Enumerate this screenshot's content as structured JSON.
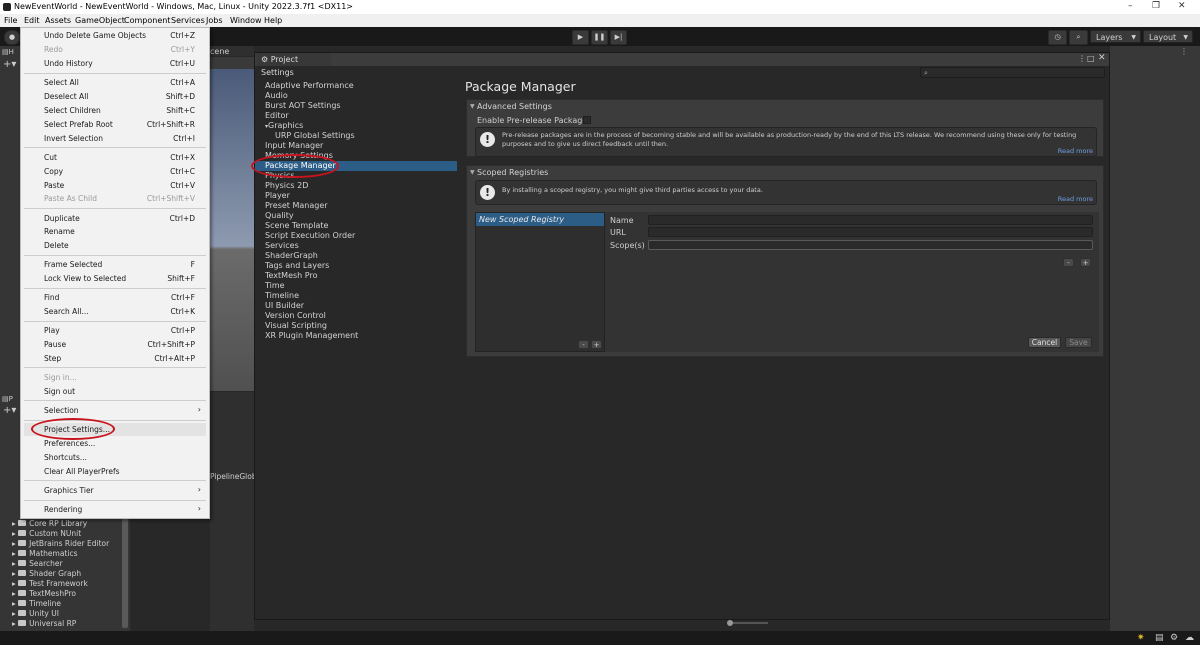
{
  "titlebar": {
    "title": "NewEventWorld - NewEventWorld - Windows, Mac, Linux - Unity 2022.3.7f1 <DX11>",
    "minimize": "–",
    "maximize": "❐",
    "close": "✕"
  },
  "menubar": [
    "File",
    "Edit",
    "Assets",
    "GameObject",
    "Component",
    "Services",
    "Jobs",
    "Window",
    "Help"
  ],
  "toolbar": {
    "layers": "Layers",
    "layout": "Layout"
  },
  "tabs": {
    "scene": "cene"
  },
  "edit_menu": {
    "items": [
      {
        "label": "Undo Delete Game Objects",
        "shortcut": "Ctrl+Z"
      },
      {
        "label": "Redo",
        "shortcut": "Ctrl+Y",
        "disabled": true
      },
      {
        "label": "Undo History",
        "shortcut": "Ctrl+U"
      },
      {
        "label": "Select All",
        "shortcut": "Ctrl+A"
      },
      {
        "label": "Deselect All",
        "shortcut": "Shift+D"
      },
      {
        "label": "Select Children",
        "shortcut": "Shift+C"
      },
      {
        "label": "Select Prefab Root",
        "shortcut": "Ctrl+Shift+R"
      },
      {
        "label": "Invert Selection",
        "shortcut": "Ctrl+I"
      },
      {
        "label": "Cut",
        "shortcut": "Ctrl+X"
      },
      {
        "label": "Copy",
        "shortcut": "Ctrl+C"
      },
      {
        "label": "Paste",
        "shortcut": "Ctrl+V"
      },
      {
        "label": "Paste As Child",
        "shortcut": "Ctrl+Shift+V",
        "disabled": true
      },
      {
        "label": "Duplicate",
        "shortcut": "Ctrl+D"
      },
      {
        "label": "Rename",
        "shortcut": ""
      },
      {
        "label": "Delete",
        "shortcut": ""
      },
      {
        "label": "Frame Selected",
        "shortcut": "F"
      },
      {
        "label": "Lock View to Selected",
        "shortcut": "Shift+F"
      },
      {
        "label": "Find",
        "shortcut": "Ctrl+F"
      },
      {
        "label": "Search All...",
        "shortcut": "Ctrl+K"
      },
      {
        "label": "Play",
        "shortcut": "Ctrl+P"
      },
      {
        "label": "Pause",
        "shortcut": "Ctrl+Shift+P"
      },
      {
        "label": "Step",
        "shortcut": "Ctrl+Alt+P"
      },
      {
        "label": "Sign in...",
        "shortcut": "",
        "disabled": true
      },
      {
        "label": "Sign out",
        "shortcut": ""
      },
      {
        "label": "Selection",
        "shortcut": "",
        "submenu": true
      },
      {
        "label": "Project Settings...",
        "shortcut": ""
      },
      {
        "label": "Preferences...",
        "shortcut": ""
      },
      {
        "label": "Shortcuts...",
        "shortcut": ""
      },
      {
        "label": "Clear All PlayerPrefs",
        "shortcut": ""
      },
      {
        "label": "Graphics Tier",
        "shortcut": "",
        "submenu": true
      },
      {
        "label": "Rendering",
        "shortcut": "",
        "submenu": true
      }
    ]
  },
  "project_tree": [
    "Core RP Library",
    "Custom NUnit",
    "JetBrains Rider Editor",
    "Mathematics",
    "Searcher",
    "Shader Graph",
    "Test Framework",
    "TextMeshPro",
    "Timeline",
    "Unity UI",
    "Universal RP"
  ],
  "bg_text": "PipelineGlob",
  "project_settings": {
    "tab": "Project Settings",
    "list": [
      "Adaptive Performance",
      "Audio",
      "Burst AOT Settings",
      "Editor",
      "Graphics",
      "URP Global Settings",
      "Input Manager",
      "Memory Settings",
      "Package Manager",
      "Physics",
      "Physics 2D",
      "Player",
      "Preset Manager",
      "Quality",
      "Scene Template",
      "Script Execution Order",
      "Services",
      "ShaderGraph",
      "Tags and Layers",
      "TextMesh Pro",
      "Time",
      "Timeline",
      "UI Builder",
      "Version Control",
      "Visual Scripting",
      "XR Plugin Management"
    ],
    "title": "Package Manager",
    "advanced": {
      "header": "Advanced Settings",
      "prerelease_label": "Enable Pre-release Packages",
      "help": "Pre-release packages are in the process of becoming stable and will be available as production-ready by the end of this LTS release. We recommend using these only for testing purposes and to give us direct feedback until then.",
      "read_more": "Read more"
    },
    "scoped": {
      "header": "Scoped Registries",
      "help": "By installing a scoped registry, you might give third parties access to your data.",
      "read_more": "Read more",
      "registry": "New Scoped Registry",
      "name_label": "Name",
      "url_label": "URL",
      "scopes_label": "Scope(s)",
      "minus": "-",
      "plus": "+",
      "cancel": "Cancel",
      "save": "Save"
    }
  },
  "colors": {
    "selection": "#2c5d87",
    "highlight_ring": "#c8141e",
    "link": "#6f9ee0"
  }
}
